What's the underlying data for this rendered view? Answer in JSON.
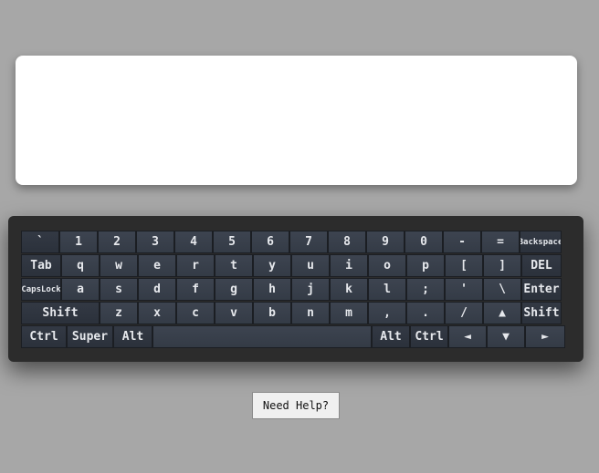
{
  "textarea": {
    "value": ""
  },
  "help_button": {
    "label": "Need Help?"
  },
  "keyboard": {
    "rows": [
      [
        {
          "label": "`"
        },
        {
          "label": "1"
        },
        {
          "label": "2"
        },
        {
          "label": "3"
        },
        {
          "label": "4"
        },
        {
          "label": "5"
        },
        {
          "label": "6"
        },
        {
          "label": "7"
        },
        {
          "label": "8"
        },
        {
          "label": "9"
        },
        {
          "label": "0"
        },
        {
          "label": "-"
        },
        {
          "label": "="
        },
        {
          "label": "Backspace"
        }
      ],
      [
        {
          "label": "Tab"
        },
        {
          "label": "q"
        },
        {
          "label": "w"
        },
        {
          "label": "e"
        },
        {
          "label": "r"
        },
        {
          "label": "t"
        },
        {
          "label": "y"
        },
        {
          "label": "u"
        },
        {
          "label": "i"
        },
        {
          "label": "o"
        },
        {
          "label": "p"
        },
        {
          "label": "["
        },
        {
          "label": "]"
        },
        {
          "label": "DEL"
        }
      ],
      [
        {
          "label": "CapsLock"
        },
        {
          "label": "a"
        },
        {
          "label": "s"
        },
        {
          "label": "d"
        },
        {
          "label": "f"
        },
        {
          "label": "g"
        },
        {
          "label": "h"
        },
        {
          "label": "j"
        },
        {
          "label": "k"
        },
        {
          "label": "l"
        },
        {
          "label": ";"
        },
        {
          "label": "'"
        },
        {
          "label": "\\"
        },
        {
          "label": "Enter"
        }
      ],
      [
        {
          "label": "Shift"
        },
        {
          "label": "z"
        },
        {
          "label": "x"
        },
        {
          "label": "c"
        },
        {
          "label": "v"
        },
        {
          "label": "b"
        },
        {
          "label": "n"
        },
        {
          "label": "m"
        },
        {
          "label": ","
        },
        {
          "label": "."
        },
        {
          "label": "/"
        },
        {
          "label": "▲"
        },
        {
          "label": "Shift"
        }
      ],
      [
        {
          "label": "Ctrl"
        },
        {
          "label": "Super"
        },
        {
          "label": "Alt"
        },
        {
          "label": ""
        },
        {
          "label": "Alt"
        },
        {
          "label": "Ctrl"
        },
        {
          "label": "◄"
        },
        {
          "label": "▼"
        },
        {
          "label": "►"
        }
      ]
    ]
  }
}
